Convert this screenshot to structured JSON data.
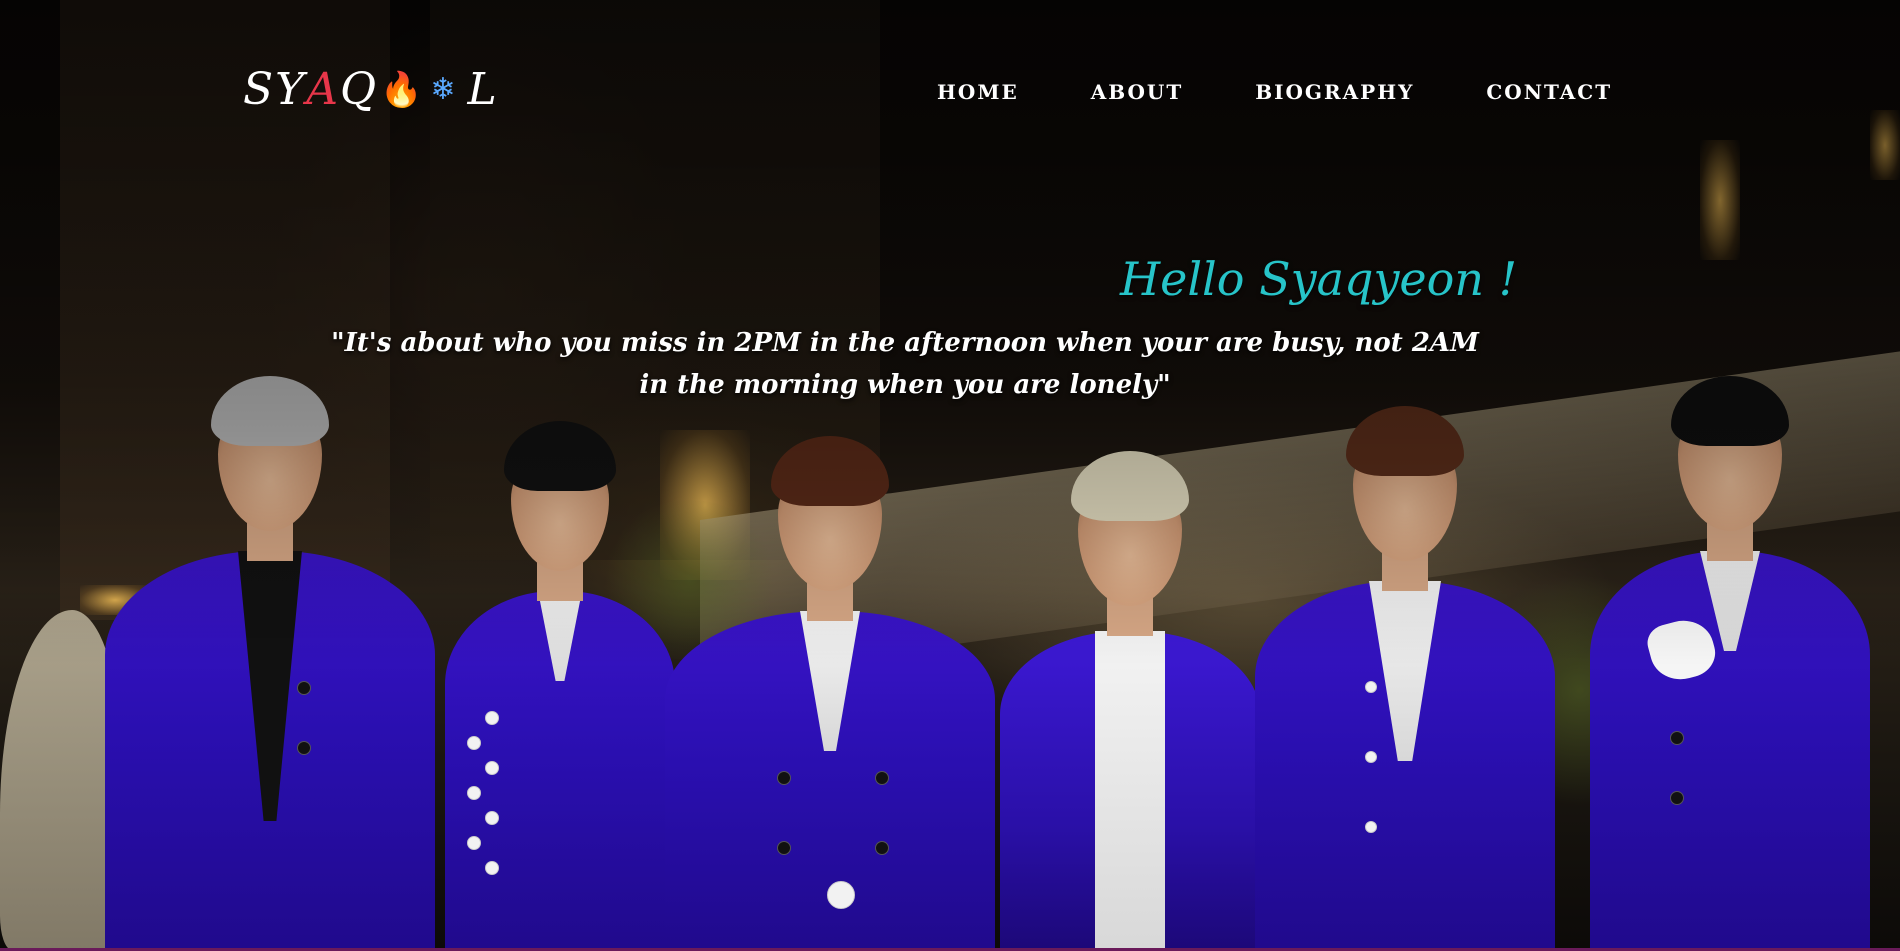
{
  "header": {
    "logo": {
      "prefix": "SY",
      "accent": "A",
      "middle": "Q",
      "fire_icon": "🔥",
      "snow_icon": "❄",
      "suffix": "L"
    },
    "nav": [
      {
        "label": "HOME"
      },
      {
        "label": "ABOUT"
      },
      {
        "label": "BIOGRAPHY"
      },
      {
        "label": "CONTACT"
      }
    ]
  },
  "hero": {
    "greeting": "Hello Syaqyeon !",
    "quote": "\"It's about who you miss in 2PM in the afternoon when your are busy, not 2AM in the morning when you are lonely\"",
    "image": "group-photo-six-men-blue-suits"
  },
  "colors": {
    "greeting": "#27c4c9",
    "logo_accent": "#e8364a",
    "suit_blue": "#2a0fb0"
  }
}
